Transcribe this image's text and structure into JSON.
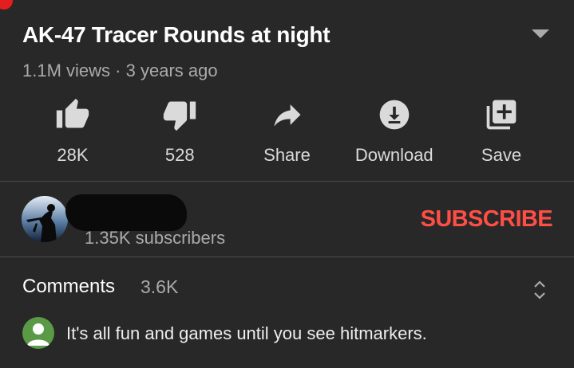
{
  "video": {
    "title": "AK-47 Tracer Rounds at night",
    "views": "1.1M views",
    "separator": "·",
    "age": "3 years ago"
  },
  "actions": [
    {
      "icon": "thumbs-up-icon",
      "label": "28K"
    },
    {
      "icon": "thumbs-down-icon",
      "label": "528"
    },
    {
      "icon": "share-icon",
      "label": "Share"
    },
    {
      "icon": "download-icon",
      "label": "Download"
    },
    {
      "icon": "save-playlist-icon",
      "label": "Save"
    }
  ],
  "channel": {
    "subscribers": "1.35K subscribers",
    "subscribe_label": "SUBSCRIBE",
    "subscribe_color": "#ff4e45"
  },
  "comments": {
    "title": "Comments",
    "count": "3.6K",
    "top_comment": "It's all fun and games until you see hitmarkers."
  },
  "colors": {
    "background": "#282828",
    "secondary_text": "#aaaaaa",
    "divider": "#4a4a4a"
  }
}
